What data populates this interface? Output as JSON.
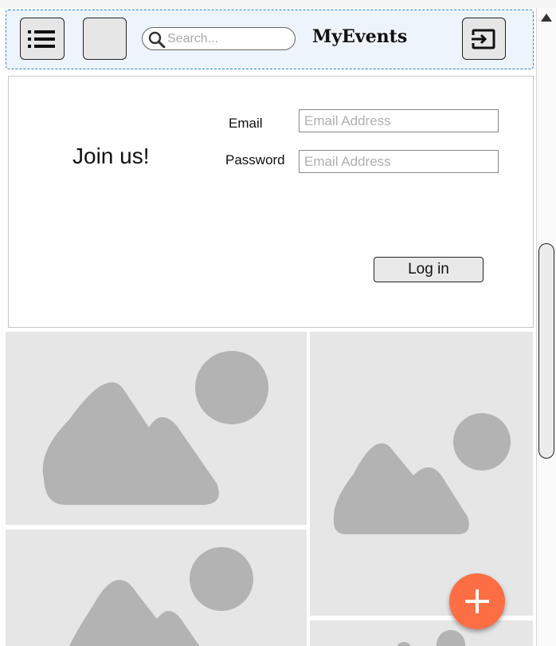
{
  "header": {
    "menu_icon": "list-icon",
    "blank_button_icon": "blank-square",
    "search": {
      "placeholder": "Search..."
    },
    "brand": "MyEvents",
    "logout_icon": "sign-in-arrow-icon"
  },
  "login": {
    "heading": "Join us!",
    "email_label": "Email",
    "email_placeholder": "Email Address",
    "password_label": "Password",
    "password_placeholder": "Email Address",
    "login_button": "Log in"
  },
  "gallery": {
    "tile_icon": "image-placeholder-icon",
    "tile_count": 5
  },
  "fab": {
    "icon": "plus-icon",
    "color": "#fe6e45"
  },
  "colors": {
    "header_bg": "#eef4fc",
    "header_border": "#2e88c4",
    "tile_bg": "#e6e6e6",
    "image_glyph": "#b3b3b3"
  }
}
